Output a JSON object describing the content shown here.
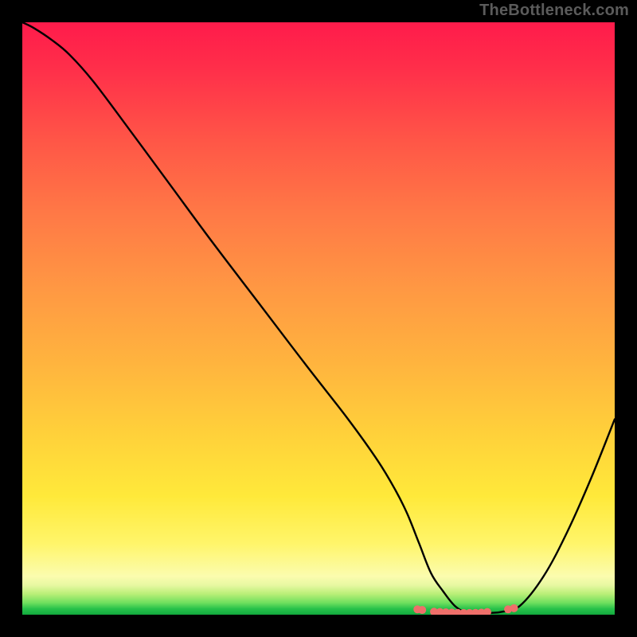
{
  "watermark": "TheBottleneck.com",
  "colors": {
    "background": "#000000",
    "curve_stroke": "#000000",
    "marker_fill": "#ef6f6a",
    "watermark_text": "#5b5b5b"
  },
  "chart_data": {
    "type": "line",
    "title": "",
    "xlabel": "",
    "ylabel": "",
    "xlim": [
      0,
      100
    ],
    "ylim": [
      0,
      100
    ],
    "grid": false,
    "legend": false,
    "x": [
      0,
      2,
      5,
      8,
      12,
      18,
      25,
      32,
      40,
      48,
      55,
      60,
      63,
      65,
      67,
      69,
      71,
      73,
      75,
      77,
      79,
      81,
      84,
      88,
      92,
      96,
      100
    ],
    "y": [
      100,
      99,
      97,
      94.5,
      90,
      82,
      72.5,
      63,
      52.5,
      42,
      33,
      26,
      21,
      17,
      12,
      7,
      4,
      1.5,
      0.3,
      0.2,
      0.3,
      0.5,
      1.5,
      6.5,
      14,
      23,
      33
    ],
    "markers": [
      {
        "x": 66.7,
        "y": 0.9
      },
      {
        "x": 67.5,
        "y": 0.8
      },
      {
        "x": 69.5,
        "y": 0.5
      },
      {
        "x": 70.5,
        "y": 0.45
      },
      {
        "x": 71.5,
        "y": 0.4
      },
      {
        "x": 72.5,
        "y": 0.35
      },
      {
        "x": 73.5,
        "y": 0.3
      },
      {
        "x": 74.5,
        "y": 0.28
      },
      {
        "x": 75.5,
        "y": 0.28
      },
      {
        "x": 76.5,
        "y": 0.3
      },
      {
        "x": 77.5,
        "y": 0.35
      },
      {
        "x": 78.5,
        "y": 0.45
      },
      {
        "x": 82.0,
        "y": 0.9
      },
      {
        "x": 83.0,
        "y": 1.1
      }
    ],
    "annotations": []
  }
}
